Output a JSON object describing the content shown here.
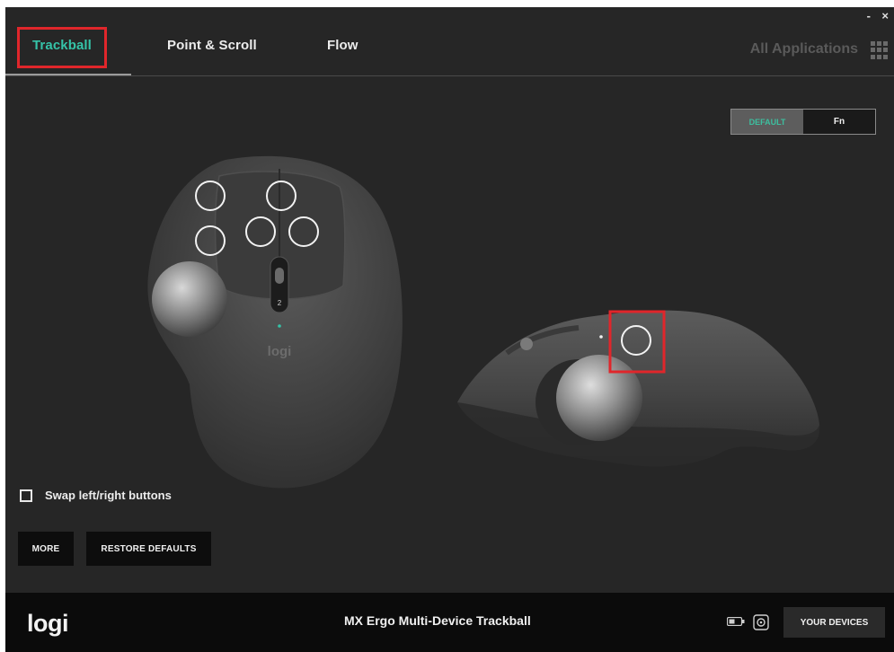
{
  "window": {
    "minimize_glyph": "-",
    "close_glyph": "×"
  },
  "tabs": [
    {
      "label": "Trackball",
      "active": true
    },
    {
      "label": "Point & Scroll",
      "active": false
    },
    {
      "label": "Flow",
      "active": false
    }
  ],
  "header": {
    "all_applications": "All Applications",
    "apps_icon": "grid-icon"
  },
  "mode_toggle": {
    "default_label": "DEFAULT",
    "fn_label": "Fn",
    "selected": "DEFAULT"
  },
  "device_art": {
    "logo_text": "logi",
    "dpi_badge": "2"
  },
  "swap_buttons": {
    "label": "Swap left/right buttons",
    "checked": false
  },
  "buttons": {
    "more": "MORE",
    "restore": "RESTORE DEFAULTS"
  },
  "footer": {
    "logo": "logi",
    "device_name": "MX Ergo Multi-Device Trackball",
    "your_devices": "YOUR DEVICES",
    "battery_icon": "battery-icon",
    "receiver_icon": "unifying-receiver-icon"
  },
  "colors": {
    "accent": "#35c3a8",
    "background": "#262626",
    "highlight_box": "#e0262b",
    "footer": "#0b0b0b"
  }
}
